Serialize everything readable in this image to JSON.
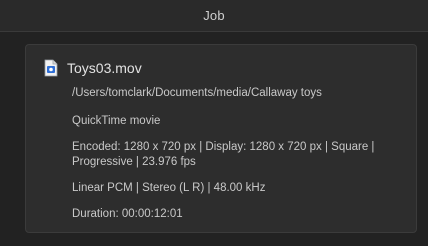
{
  "window": {
    "title": "Job"
  },
  "job_panel": {
    "file_icon": "movie-file-icon",
    "file_name": "Toys03.mov",
    "path": "/Users/tomclark/Documents/media/Callaway toys",
    "format": "QuickTime movie",
    "video_info": "Encoded: 1280 x 720 px | Display: 1280 x 720 px | Square | Progressive | 23.976 fps",
    "audio_info": "Linear PCM | Stereo (L R) | 48.00 kHz",
    "duration": "Duration: 00:00:12:01"
  }
}
